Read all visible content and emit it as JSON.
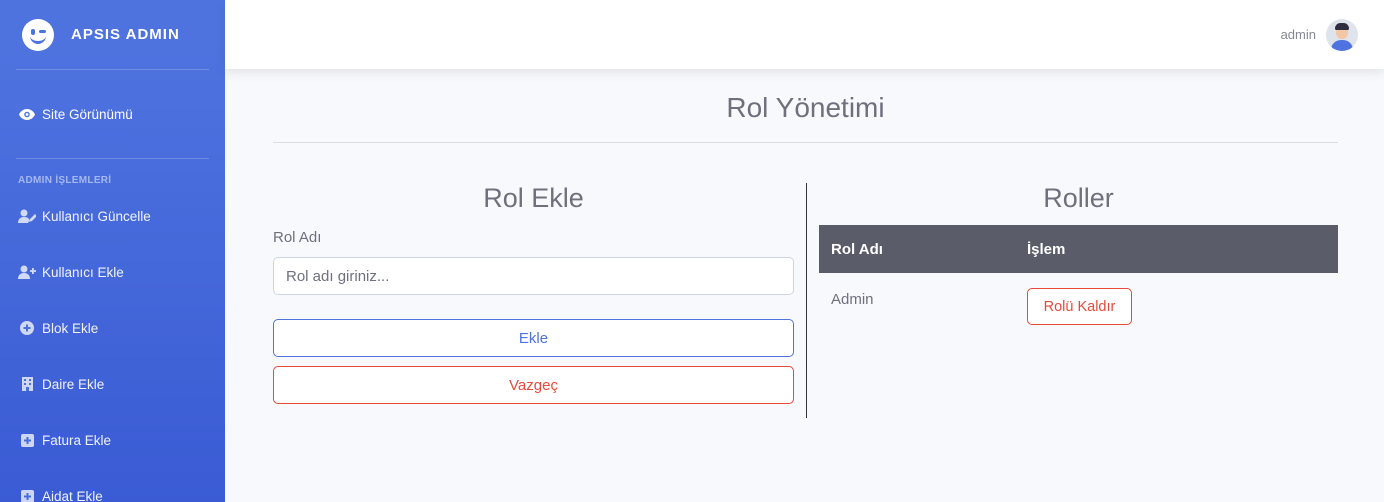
{
  "brand": {
    "name": "APSIS ADMIN",
    "icon": "laugh-wink-icon"
  },
  "sidebar": {
    "site_view": {
      "label": "Site Görünümü",
      "icon": "eye-icon"
    },
    "heading": "ADMIN İŞLEMLERİ",
    "items": [
      {
        "label": "Kullanıcı Güncelle",
        "icon": "user-edit-icon"
      },
      {
        "label": "Kullanıcı Ekle",
        "icon": "user-plus-icon"
      },
      {
        "label": "Blok Ekle",
        "icon": "plus-circle-icon"
      },
      {
        "label": "Daire Ekle",
        "icon": "building-icon"
      },
      {
        "label": "Fatura Ekle",
        "icon": "plus-square-icon"
      },
      {
        "label": "Aidat Ekle",
        "icon": "plus-square-icon"
      }
    ]
  },
  "topbar": {
    "user_name": "admin"
  },
  "page": {
    "title": "Rol Yönetimi"
  },
  "add_role": {
    "title": "Rol Ekle",
    "field_label": "Rol Adı",
    "placeholder": "Rol adı giriniz...",
    "value": "",
    "add_label": "Ekle",
    "cancel_label": "Vazgeç"
  },
  "roles": {
    "title": "Roller",
    "columns": [
      "Rol Adı",
      "İşlem"
    ],
    "rows": [
      {
        "name": "Admin",
        "action_label": "Rolü Kaldır"
      }
    ]
  },
  "colors": {
    "primary": "#4e73df",
    "danger": "#e74a3b",
    "table_header": "#5a5c69"
  }
}
